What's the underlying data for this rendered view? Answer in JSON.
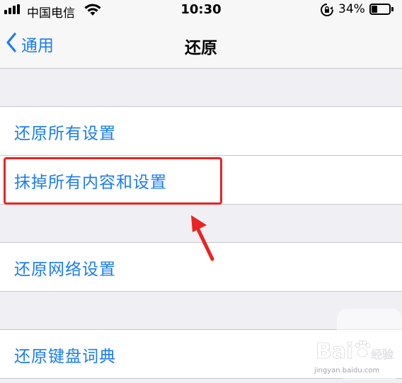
{
  "status_bar": {
    "carrier": "中国电信",
    "time": "10:30",
    "battery_percent": "34%",
    "battery_level": 0.34,
    "icons": [
      "signal-icon",
      "wifi-icon",
      "orientation-lock-icon",
      "battery-icon"
    ]
  },
  "nav": {
    "back_label": "通用",
    "title": "还原"
  },
  "groups": [
    {
      "items": [
        "还原所有设置",
        "抹掉所有内容和设置"
      ]
    },
    {
      "items": [
        "还原网络设置"
      ]
    },
    {
      "items": [
        "还原键盘词典"
      ]
    }
  ],
  "annotation": {
    "highlight_color": "#ea2323",
    "highlighted_item": "抹掉所有内容和设置"
  },
  "watermark": {
    "brand": "Bai",
    "brand_suffix": "经验",
    "url": "jingyan.baidu.com"
  },
  "colors": {
    "accent": "#1a7cf4",
    "background": "#efeff4",
    "separator": "#c8c7cc"
  }
}
